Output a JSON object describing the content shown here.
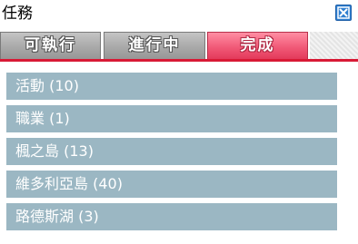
{
  "window": {
    "title": "任務",
    "close_icon": "close-x-icon"
  },
  "tabs": [
    {
      "label": "可執行",
      "active": false
    },
    {
      "label": "進行中",
      "active": false
    },
    {
      "label": "完成",
      "active": true
    }
  ],
  "categories": [
    {
      "label": "活動 (10)"
    },
    {
      "label": "職業 (1)"
    },
    {
      "label": "楓之島 (13)"
    },
    {
      "label": "維多利亞島 (40)"
    },
    {
      "label": "路德斯湖 (3)"
    }
  ],
  "colors": {
    "active_tab": "#f15a78",
    "inactive_tab": "#a9a9a9",
    "underline": "#d81a36",
    "row_bg": "#9bb7c3",
    "close_button": "#2f7fd0"
  }
}
